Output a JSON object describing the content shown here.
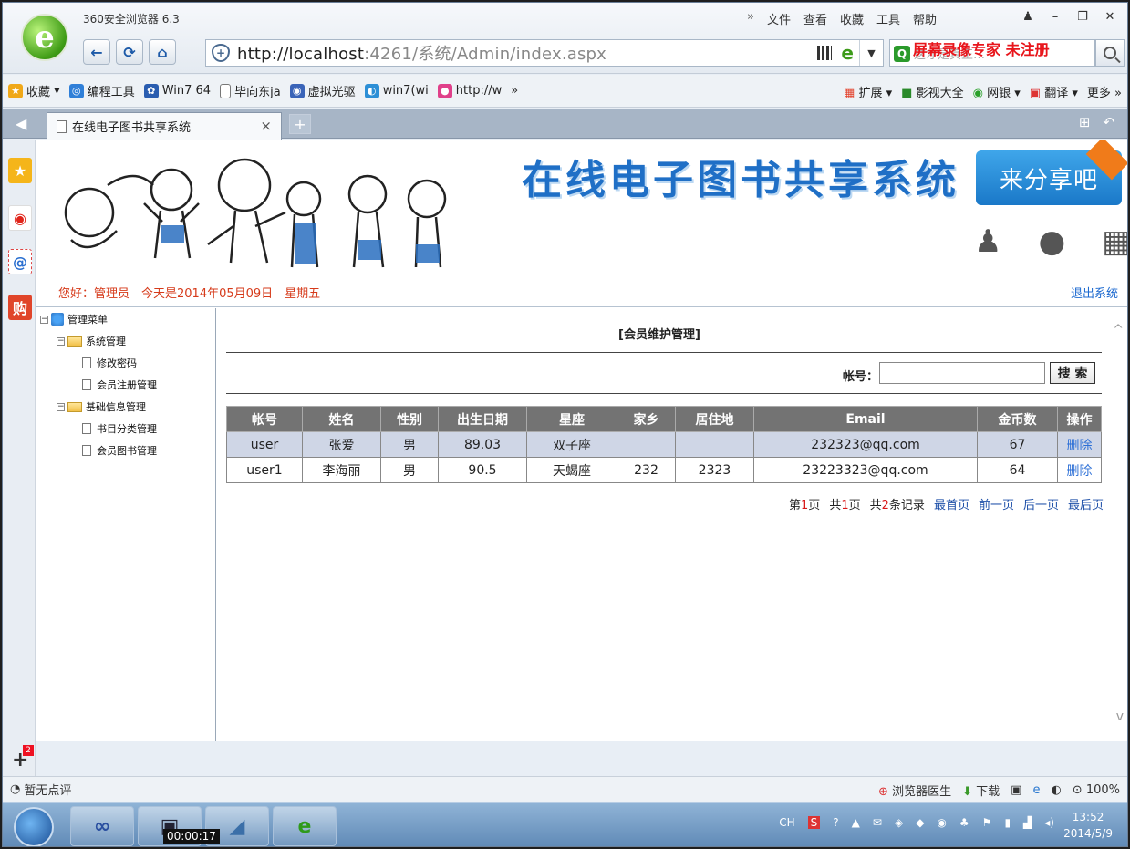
{
  "browser": {
    "title": "360安全浏览器 6.3",
    "menu": [
      "文件",
      "查看",
      "收藏",
      "工具",
      "帮助"
    ],
    "url_host": "http://localhost",
    "url_rest": ":4261/系统/Admin/index.aspx",
    "search_placeholder": "这才是真正…",
    "watermark": "屏幕录像专家 未注册"
  },
  "bookmarks": {
    "items": [
      {
        "label": "收藏",
        "icon": "star-icon",
        "color": "#f0a818"
      },
      {
        "label": "编程工具",
        "icon": "tool-icon",
        "color": "#2f7fd8"
      },
      {
        "label": "Win7 64",
        "icon": "paw-icon",
        "color": "#2a5db0"
      },
      {
        "label": "毕向东ja",
        "icon": "page-icon",
        "color": "#ffffff"
      },
      {
        "label": "虚拟光驱",
        "icon": "disc-icon",
        "color": "#3a64b8"
      },
      {
        "label": "win7(wi",
        "icon": "globe-icon",
        "color": "#2d8fd6"
      },
      {
        "label": "http://w",
        "icon": "link-icon",
        "color": "#e0408a"
      }
    ],
    "more": "»",
    "right": [
      "扩展",
      "影视大全",
      "网银",
      "翻译",
      "更多 »"
    ]
  },
  "tab": {
    "title": "在线电子图书共享系统",
    "close": "×",
    "add": "+"
  },
  "banner": {
    "title": "在线电子图书共享系统",
    "share_button": "来分享吧",
    "greeting": "您好：管理员　今天是2014年05月09日　星期五",
    "logout": "退出系统"
  },
  "tree": {
    "root": "管理菜单",
    "groups": [
      {
        "label": "系统管理",
        "items": [
          "修改密码",
          "会员注册管理"
        ]
      },
      {
        "label": "基础信息管理",
        "items": [
          "书目分类管理",
          "会员图书管理"
        ]
      }
    ]
  },
  "main": {
    "title": "[会员维护管理]",
    "search_label": "帐号：",
    "search_button": "搜 索",
    "columns": [
      "帐号",
      "姓名",
      "性别",
      "出生日期",
      "星座",
      "家乡",
      "居住地",
      "Email",
      "金币数",
      "操作"
    ],
    "rows": [
      [
        "user",
        "张爱",
        "男",
        "89.03",
        "双子座",
        "",
        "",
        "232323@qq.com",
        "67",
        "删除"
      ],
      [
        "user1",
        "李海丽",
        "男",
        "90.5",
        "天蝎座",
        "232",
        "2323",
        "23223323@qq.com",
        "64",
        "删除"
      ]
    ],
    "pager": {
      "page_prefix": "第",
      "page_num": "1",
      "page_suffix": "页",
      "total_prefix": "共",
      "total_pages": "1",
      "total_suffix": "页",
      "records_prefix": "共",
      "records": "2",
      "records_suffix": "条记录",
      "first": "最首页",
      "prev": "前一页",
      "next": "后一页",
      "last": "最后页"
    }
  },
  "status": {
    "left": "暂无点评",
    "doctor": "浏览器医生",
    "download": "下载",
    "zoom": "100%"
  },
  "taskbar": {
    "timer": "00:00:17",
    "time": "13:52",
    "date": "2014/5/9",
    "lang": "CH"
  },
  "sidepanel": {
    "badge": "2"
  }
}
